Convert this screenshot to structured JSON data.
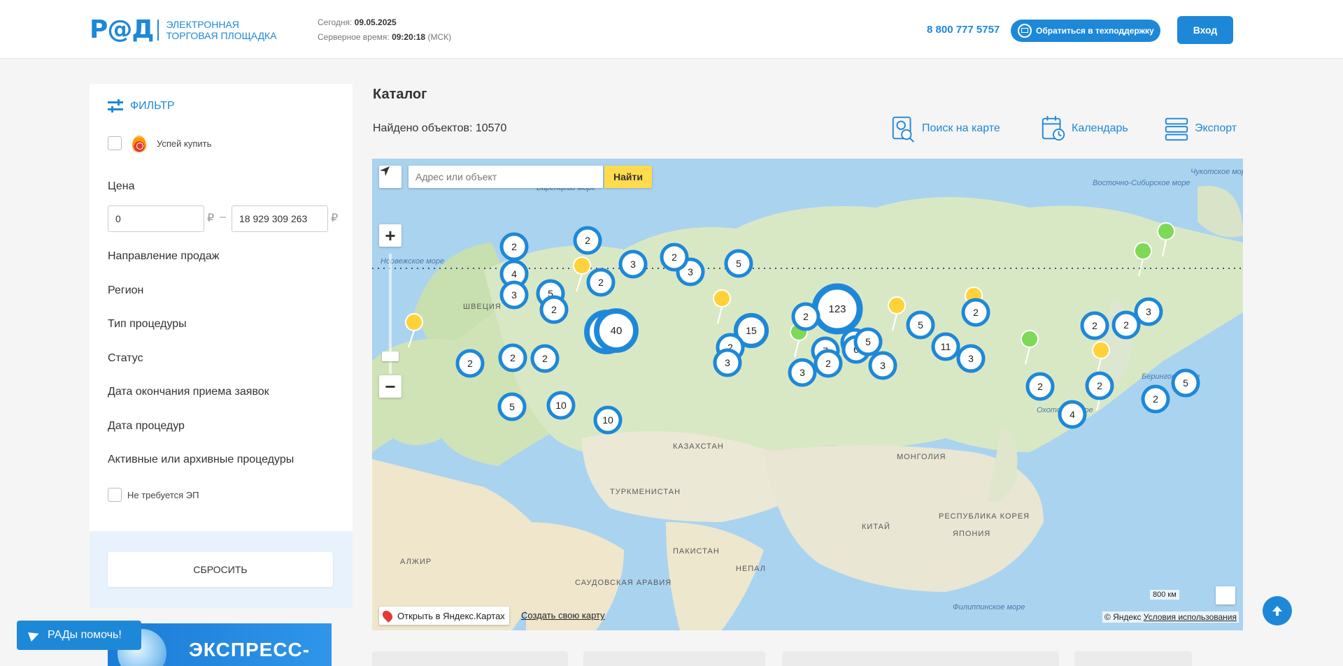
{
  "header": {
    "logo_mark": "Р@Д",
    "logo_line1": "ЭЛЕКТРОННАЯ",
    "logo_line2": "ТОРГОВАЯ ПЛОЩАДКА",
    "today_label": "Сегодня:",
    "today_value": "09.05.2025",
    "server_time_label": "Серверное время:",
    "server_time_value": "09:20:18",
    "server_tz": "(МСК)",
    "phone": "8 800 777 5757",
    "support_label": "Обратиться в техподдержку",
    "login_label": "Вход"
  },
  "filter": {
    "title": "ФИЛЬТР",
    "hurry_label": "Успей купить",
    "price_title": "Цена",
    "price_from": "0",
    "price_to": "18 929 309 263",
    "currency": "₽",
    "dash": "–",
    "items": [
      "Направление продаж",
      "Регион",
      "Тип процедуры",
      "Статус",
      "Дата окончания приема заявок",
      "Дата процедур",
      "Активные или архивные процедуры"
    ],
    "no_ep_label": "Не требуется ЭП",
    "reset_label": "СБРОСИТЬ"
  },
  "promo": {
    "text": "ЭКСПРЕСС-"
  },
  "help": {
    "label": "РАДы помочь!"
  },
  "catalog": {
    "title": "Каталог",
    "found": "Найдено объектов: 10570",
    "tools": [
      {
        "icon": "map-search-icon",
        "label": "Поиск на карте"
      },
      {
        "icon": "calendar-icon",
        "label": "Календарь"
      },
      {
        "icon": "export-icon",
        "label": "Экспорт"
      }
    ]
  },
  "map": {
    "search_placeholder": "Адрес или объект",
    "find_label": "Найти",
    "open_label": "Открыть в Яндекс.Картах",
    "create_label": "Создать свою карту",
    "copyright": "© Яндекс",
    "terms": "Условия использования",
    "scale": "800 км",
    "labels": {
      "barents": "Баренцево море",
      "norway": "Норвежское море",
      "east_sib": "Восточно-Сибирское море",
      "chukchi": "Чукотское море",
      "bering": "Берингово море",
      "okhotsk": "Охотское море",
      "philippine": "Филиппинское море",
      "kazakhstan": "КАЗАХСТАН",
      "turkmenistan": "ТУРКМЕНИСТАН",
      "pakistan": "ПАКИСТАН",
      "saudi": "САУДОВСКАЯ АРАВИЯ",
      "china": "КИТАЙ",
      "mongolia": "МОНГОЛИЯ",
      "alger": "АЛЖИР",
      "sweden": "ШВЕЦИЯ",
      "korea": "РЕСПУБЛИКА КОРЕЯ",
      "japan": "ЯПОНИЯ",
      "nepal": "НЕПАЛ"
    },
    "clusters": [
      "2",
      "4",
      "3",
      "5",
      "2",
      "3",
      "2",
      "2",
      "9",
      "40",
      "15",
      "123",
      "5",
      "3",
      "7",
      "2",
      "3",
      "5",
      "3",
      "2",
      "2",
      "2",
      "6",
      "5",
      "2",
      "3",
      "11",
      "2",
      "3",
      "3",
      "2",
      "5",
      "2",
      "2",
      "3",
      "2",
      "4",
      "5",
      "10",
      "10",
      "2",
      "2",
      "2"
    ]
  },
  "colors": {
    "accent": "#1e88d8",
    "find": "#ffdb4d"
  }
}
